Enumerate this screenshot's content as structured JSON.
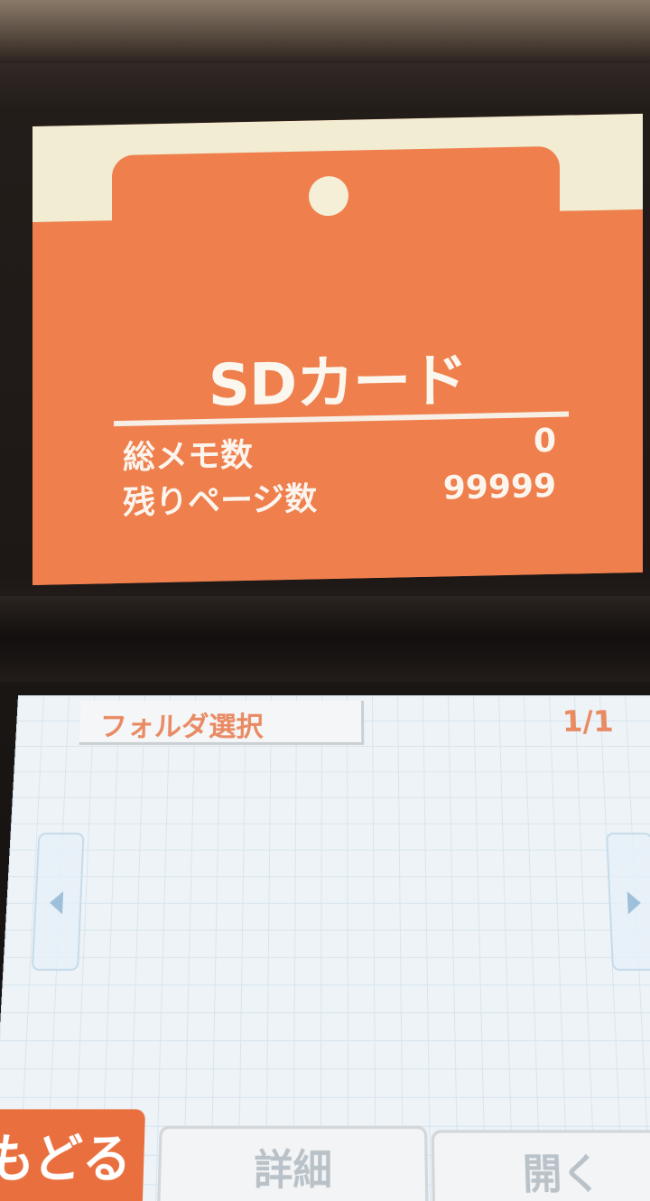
{
  "top_screen": {
    "title": "SDカード",
    "stats": [
      {
        "label": "総メモ数",
        "value": "0"
      },
      {
        "label": "残りページ数",
        "value": "99999"
      }
    ]
  },
  "bottom_screen": {
    "header": "フォルダ選択",
    "page_indicator": "1/1",
    "buttons": {
      "back": "もどる",
      "detail": "詳細",
      "open": "開く"
    }
  },
  "colors": {
    "accent_orange": "#ef7f4c",
    "cream": "#f1ecd2",
    "grid_blue": "#d7e6f0"
  }
}
